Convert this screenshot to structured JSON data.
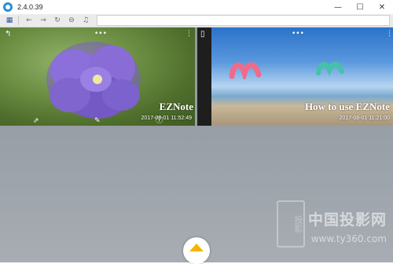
{
  "window": {
    "title": "2.4.0.39",
    "minimize": "—",
    "maximize": "☐",
    "close": "✕"
  },
  "toolbar": {
    "grid": "▦",
    "back": "←",
    "forward": "→",
    "refresh": "↻",
    "stop": "⊖",
    "music": "♫"
  },
  "notes": [
    {
      "title": "EZNote",
      "date": "2017-08-01 11:52:49"
    },
    {
      "title": "How to use EZNote",
      "date": "2017-08-01 11:21:00"
    }
  ],
  "watermark": {
    "brand": "中国投影网",
    "url": "www.ty360.com",
    "seal": "投影"
  }
}
